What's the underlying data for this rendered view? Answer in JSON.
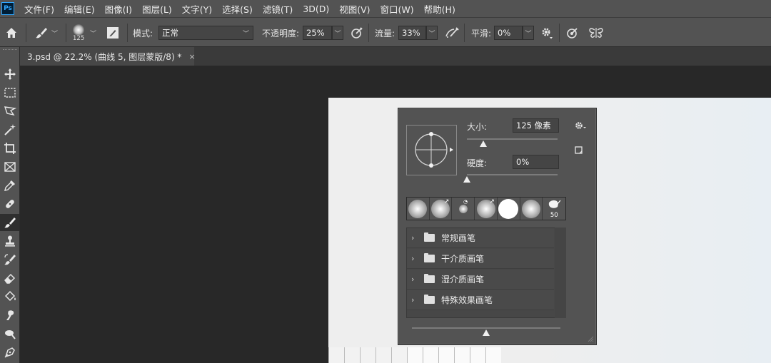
{
  "app": {
    "logo": "Ps"
  },
  "menu": [
    "文件(F)",
    "编辑(E)",
    "图像(I)",
    "图层(L)",
    "文字(Y)",
    "选择(S)",
    "滤镜(T)",
    "3D(D)",
    "视图(V)",
    "窗口(W)",
    "帮助(H)"
  ],
  "options": {
    "brush_size": "125",
    "mode_label": "模式:",
    "mode_value": "正常",
    "opacity_label": "不透明度:",
    "opacity_value": "25%",
    "flow_label": "流量:",
    "flow_value": "33%",
    "smoothing_label": "平滑:",
    "smoothing_value": "0%",
    "icons": [
      "home-icon",
      "brush-tool-icon",
      "brush-preset-icon",
      "brush-settings-icon",
      "pressure-opacity-icon",
      "airbrush-icon",
      "gear-icon",
      "pressure-size-icon",
      "symmetry-icon"
    ]
  },
  "tab": {
    "title": "3.psd @ 22.2% (曲线 5, 图层蒙版/8) *",
    "close": "×"
  },
  "toolbar": {
    "tools": [
      "move-tool",
      "marquee-tool",
      "lasso-tool",
      "magic-wand-tool",
      "crop-tool",
      "frame-tool",
      "eyedropper-tool",
      "healing-brush-tool",
      "brush-tool",
      "clone-stamp-tool",
      "history-brush-tool",
      "eraser-tool",
      "paint-bucket-tool",
      "smudge-tool",
      "dodge-tool",
      "pen-tool"
    ],
    "active": "brush-tool"
  },
  "brush_popup": {
    "size_label": "大小:",
    "size_value": "125 像素",
    "size_level": 0.18,
    "hardness_label": "硬度:",
    "hardness_value": "0%",
    "hardness_level": 0.0,
    "presets_last_size": "50",
    "folders": [
      "常规画笔",
      "干介质画笔",
      "湿介质画笔",
      "特殊效果画笔"
    ],
    "preview_scale_level": 0.5,
    "colors": {
      "panel": "#535353",
      "field": "#454545",
      "accent_thumb": "#f0f0f0"
    }
  },
  "colors": {
    "chrome": "#535353",
    "canvas_bg": "#282828",
    "document": "#eeeeee"
  }
}
